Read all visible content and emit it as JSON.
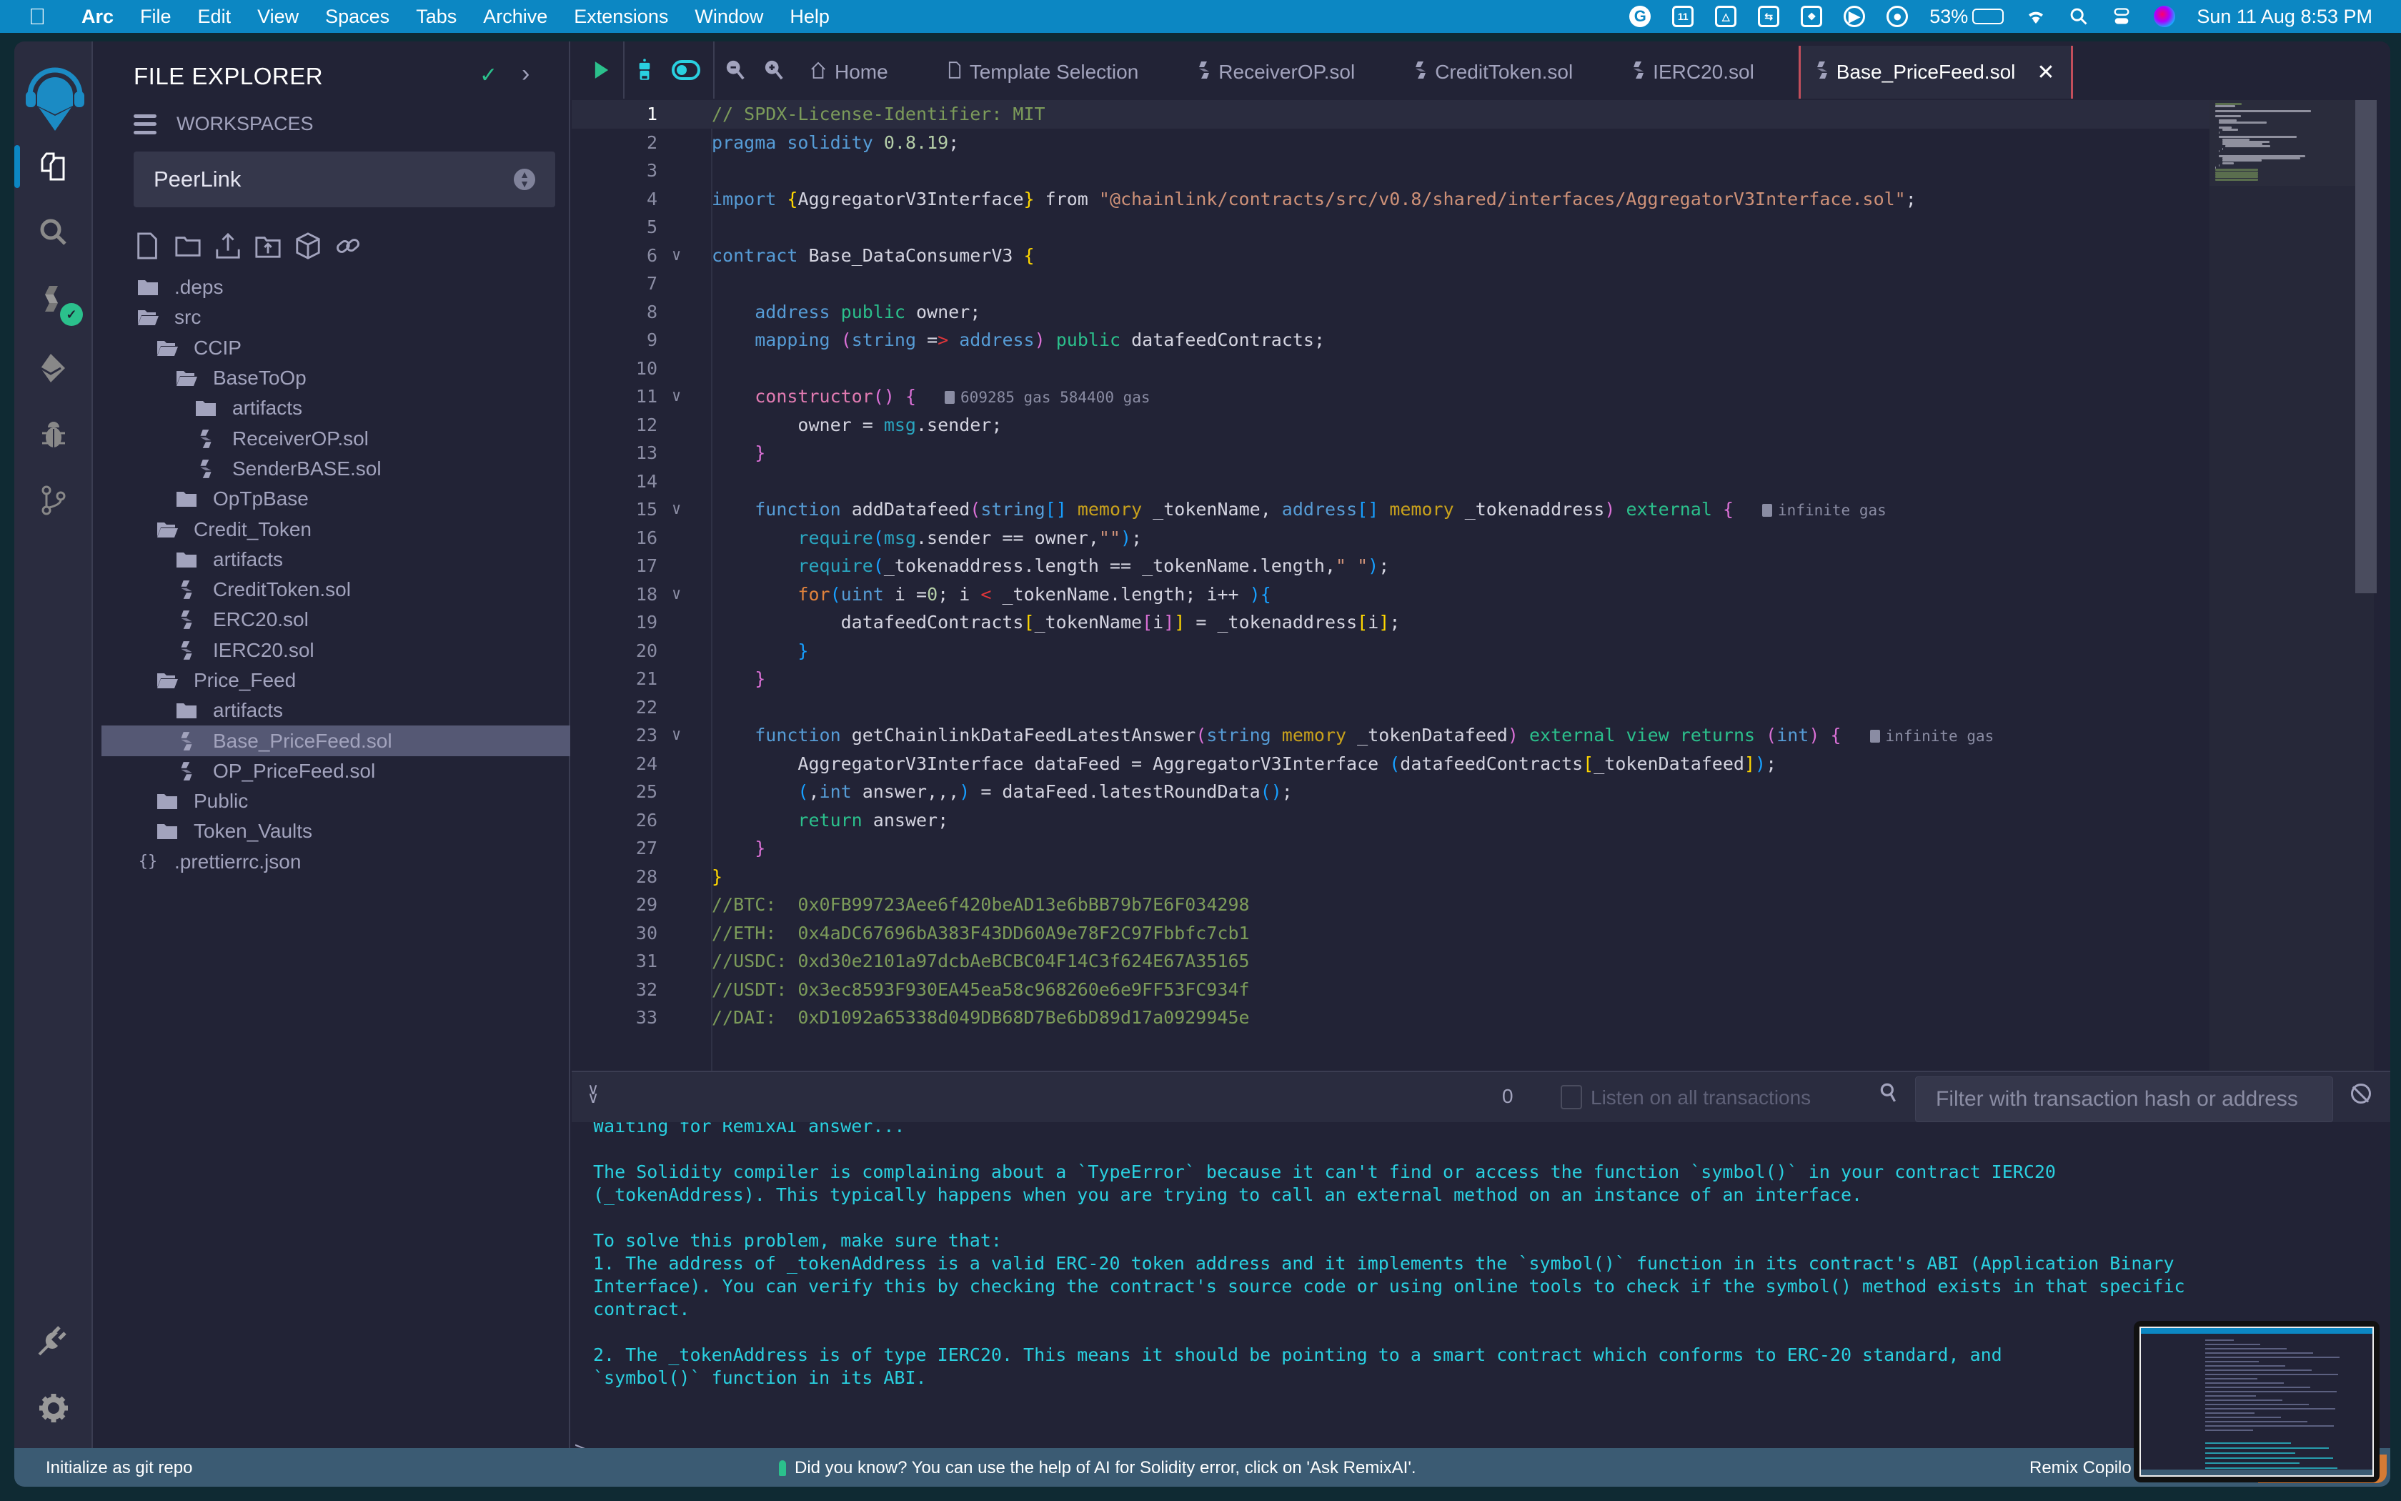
{
  "menubar": {
    "apple": "",
    "app_name": "Arc",
    "items": [
      "File",
      "Edit",
      "View",
      "Spaces",
      "Tabs",
      "Archive",
      "Extensions",
      "Window",
      "Help"
    ],
    "status_icons": [
      "grammarly-icon",
      "calendar-icon",
      "drive-icon",
      "transfer-icon",
      "pattern-icon",
      "play-icon",
      "user-icon"
    ],
    "calendar_day": "11",
    "battery_percent": "53%",
    "battery_level": 0.53,
    "datetime": "Sun 11 Aug  8:53 PM"
  },
  "rail": {
    "items": [
      "file-explorer",
      "search",
      "solidity-compiler",
      "deploy-run",
      "debugger",
      "source-control",
      "plugin-manager",
      "settings"
    ]
  },
  "explorer": {
    "title": "FILE EXPLORER",
    "workspaces_label": "WORKSPACES",
    "workspace_selected": "PeerLink",
    "tree": [
      {
        "name": ".deps",
        "type": "folder",
        "depth": 0,
        "open": false
      },
      {
        "name": "src",
        "type": "folder",
        "depth": 0,
        "open": true
      },
      {
        "name": "CCIP",
        "type": "folder",
        "depth": 1,
        "open": true
      },
      {
        "name": "BaseToOp",
        "type": "folder",
        "depth": 2,
        "open": true
      },
      {
        "name": "artifacts",
        "type": "folder",
        "depth": 3,
        "open": false
      },
      {
        "name": "ReceiverOP.sol",
        "type": "sol",
        "depth": 3
      },
      {
        "name": "SenderBASE.sol",
        "type": "sol",
        "depth": 3
      },
      {
        "name": "OpTpBase",
        "type": "folder",
        "depth": 2,
        "open": false
      },
      {
        "name": "Credit_Token",
        "type": "folder",
        "depth": 1,
        "open": true
      },
      {
        "name": "artifacts",
        "type": "folder",
        "depth": 2,
        "open": false
      },
      {
        "name": "CreditToken.sol",
        "type": "sol",
        "depth": 2
      },
      {
        "name": "ERC20.sol",
        "type": "sol",
        "depth": 2
      },
      {
        "name": "IERC20.sol",
        "type": "sol",
        "depth": 2
      },
      {
        "name": "Price_Feed",
        "type": "folder",
        "depth": 1,
        "open": true
      },
      {
        "name": "artifacts",
        "type": "folder",
        "depth": 2,
        "open": false
      },
      {
        "name": "Base_PriceFeed.sol",
        "type": "sol",
        "depth": 2,
        "selected": true
      },
      {
        "name": "OP_PriceFeed.sol",
        "type": "sol",
        "depth": 2
      },
      {
        "name": "Public",
        "type": "folder",
        "depth": 1,
        "open": false
      },
      {
        "name": "Token_Vaults",
        "type": "folder",
        "depth": 1,
        "open": false
      },
      {
        "name": ".prettierrc.json",
        "type": "json",
        "depth": 0
      }
    ]
  },
  "tabs": [
    {
      "label": "Home",
      "icon": "home-icon"
    },
    {
      "label": "Template Selection",
      "icon": "file-icon"
    },
    {
      "label": "ReceiverOP.sol",
      "icon": "solidity-icon"
    },
    {
      "label": "CreditToken.sol",
      "icon": "solidity-icon"
    },
    {
      "label": "IERC20.sol",
      "icon": "solidity-icon"
    },
    {
      "label": "Base_PriceFeed.sol",
      "icon": "solidity-icon",
      "active": true
    }
  ],
  "editor": {
    "lines": [
      {
        "n": "1",
        "fold": false,
        "html": "<span class='c-com'>// SPDX-License-Identifier: MIT</span>"
      },
      {
        "n": "2",
        "fold": false,
        "html": "<span class='c-kw'>pragma solidity</span> <span class='c-num'>0.8.19</span>;"
      },
      {
        "n": "3",
        "fold": false,
        "html": ""
      },
      {
        "n": "4",
        "fold": false,
        "html": "<span class='c-kw'>import</span> <span class='c-br1'>{</span>AggregatorV3Interface<span class='c-br1'>}</span> from <span class='c-str'>\"@chainlink/contracts/src/v0.8/shared/interfaces/AggregatorV3Interface.sol\"</span>;"
      },
      {
        "n": "5",
        "fold": false,
        "html": ""
      },
      {
        "n": "6",
        "fold": true,
        "html": "<span class='c-kw'>contract</span> Base_DataConsumerV3 <span class='c-br1'>{</span>"
      },
      {
        "n": "7",
        "fold": false,
        "html": ""
      },
      {
        "n": "8",
        "fold": false,
        "html": "    <span class='c-kw'>address</span> <span class='c-pub'>public</span> owner;"
      },
      {
        "n": "9",
        "fold": false,
        "html": "    <span class='c-kw'>mapping</span> <span class='c-br2'>(</span><span class='c-kw'>string</span> =<span class='c-red'>&gt;</span> <span class='c-kw'>address</span><span class='c-br2'>)</span> <span class='c-pub'>public</span> datafeedContracts;"
      },
      {
        "n": "10",
        "fold": false,
        "html": ""
      },
      {
        "n": "11",
        "fold": true,
        "html": "    <span class='c-ctor'>constructor</span><span class='c-br2'>()</span> <span class='c-br2'>{</span>",
        "gas": "609285 gas 584400 gas"
      },
      {
        "n": "12",
        "fold": false,
        "html": "        owner = <span class='c-msg'>msg</span>.sender;"
      },
      {
        "n": "13",
        "fold": false,
        "html": "    <span class='c-br2'>}</span>"
      },
      {
        "n": "14",
        "fold": false,
        "html": ""
      },
      {
        "n": "15",
        "fold": true,
        "html": "    <span class='c-kw'>function</span> addDatafeed<span class='c-br2'>(</span><span class='c-kw'>string</span><span class='c-br3'>[]</span> <span class='c-mem'>memory</span> _tokenName, <span class='c-kw'>address</span><span class='c-br3'>[]</span> <span class='c-mem'>memory</span> _tokenaddress<span class='c-br2'>)</span> <span class='c-pub'>external</span> <span class='c-br2'>{</span>",
        "gas": "infinite gas"
      },
      {
        "n": "16",
        "fold": false,
        "html": "        <span class='c-msg'>require</span><span class='c-br3'>(</span><span class='c-msg'>msg</span>.sender == owner,<span class='c-str'>\"\"</span><span class='c-br3'>)</span>;"
      },
      {
        "n": "17",
        "fold": false,
        "html": "        <span class='c-msg'>require</span><span class='c-br3'>(</span>_tokenaddress.length == _tokenName.length,<span class='c-str'>\" \"</span><span class='c-br3'>)</span>;"
      },
      {
        "n": "18",
        "fold": true,
        "html": "        <span class='c-for'>for</span><span class='c-br3'>(</span><span class='c-kw'>uint</span> i =<span class='c-num'>0</span>; i <span class='c-red'>&lt;</span> _tokenName.length; i++ <span class='c-br3'>){</span>"
      },
      {
        "n": "19",
        "fold": false,
        "html": "            datafeedContracts<span class='c-br1'>[</span>_tokenName<span class='c-br2'>[</span>i<span class='c-br2'>]</span><span class='c-br1'>]</span> = _tokenaddress<span class='c-br1'>[</span>i<span class='c-br1'>]</span>;"
      },
      {
        "n": "20",
        "fold": false,
        "html": "        <span class='c-br3'>}</span>"
      },
      {
        "n": "21",
        "fold": false,
        "html": "    <span class='c-br2'>}</span>"
      },
      {
        "n": "22",
        "fold": false,
        "html": ""
      },
      {
        "n": "23",
        "fold": true,
        "html": "    <span class='c-kw'>function</span> getChainlinkDataFeedLatestAnswer<span class='c-br2'>(</span><span class='c-kw'>string</span> <span class='c-mem'>memory</span> _tokenDatafeed<span class='c-br2'>)</span> <span class='c-pub'>external view returns</span> <span class='c-br2'>(</span><span class='c-kw'>int</span><span class='c-br2'>)</span> <span class='c-br2'>{</span>",
        "gas": "infinite gas"
      },
      {
        "n": "24",
        "fold": false,
        "html": "        AggregatorV3Interface dataFeed = AggregatorV3Interface <span class='c-br3'>(</span>datafeedContracts<span class='c-br1'>[</span>_tokenDatafeed<span class='c-br1'>]</span><span class='c-br3'>)</span>;"
      },
      {
        "n": "25",
        "fold": false,
        "html": "        <span class='c-br3'>(</span>,<span class='c-kw'>int</span> answer,,,<span class='c-br3'>)</span> = dataFeed.latestRoundData<span class='c-br3'>()</span>;"
      },
      {
        "n": "26",
        "fold": false,
        "html": "        <span class='c-ret'>return</span> answer;"
      },
      {
        "n": "27",
        "fold": false,
        "html": "    <span class='c-br2'>}</span>"
      },
      {
        "n": "28",
        "fold": false,
        "html": "<span class='c-br1'>}</span>"
      },
      {
        "n": "29",
        "fold": false,
        "html": "<span class='c-com'>//BTC:  0x0FB99723Aee6f420beAD13e6bBB79b7E6F034298</span>"
      },
      {
        "n": "30",
        "fold": false,
        "html": "<span class='c-com'>//ETH:  0x4aDC67696bA383F43DD60A9e78F2C97Fbbfc7cb1</span>"
      },
      {
        "n": "31",
        "fold": false,
        "html": "<span class='c-com'>//USDC: 0xd30e2101a97dcbAeBCBC04F14C3f624E67A35165</span>"
      },
      {
        "n": "32",
        "fold": false,
        "html": "<span class='c-com'>//USDT: 0x3ec8593F930EA45ea58c968260e6e9FF53FC934f</span>"
      },
      {
        "n": "33",
        "fold": false,
        "html": "<span class='c-com'>//DAI:  0xD1092a65338d049DB68D7Be6bD89d17a0929945e</span>"
      }
    ]
  },
  "terminal": {
    "tx_count": "0",
    "listen_label": "Listen on all transactions",
    "filter_placeholder": "Filter with transaction hash or address",
    "output": "Waiting for RemixAI answer...\n\nThe Solidity compiler is complaining about a `TypeError` because it can't find or access the function `symbol()` in your contract IERC20\n(_tokenAddress). This typically happens when you are trying to call an external method on an instance of an interface.\n\nTo solve this problem, make sure that:\n1. The address of _tokenAddress is a valid ERC-20 token address and it implements the `symbol()` function in its contract's ABI (Application Binary\nInterface). You can verify this by checking the contract's source code or using online tools to check if the symbol() method exists in that specific\ncontract.\n\n2. The _tokenAddress is of type IERC20. This means it should be pointing to a smart contract which conforms to ERC-20 standard, and\n`symbol()` function in its ABI.",
    "prompt": ">"
  },
  "statusbar": {
    "git": "Initialize as git repo",
    "tip": "Did you know?  You can use the help of AI for Solidity error, click on 'Ask RemixAI'.",
    "copilot": "Remix Copilo"
  },
  "colors": {
    "accent": "#0c87c3",
    "success": "#2bc08c",
    "terminal_text": "#2ad0e0",
    "active_tab_border": "#c24e5b"
  }
}
